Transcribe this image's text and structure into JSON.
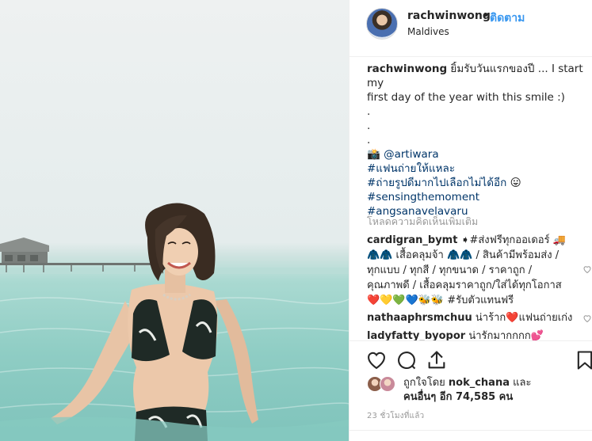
{
  "post": {
    "username": "rachwinwong",
    "dot": "•",
    "follow_label": "ติดตาม",
    "location": "Maldives"
  },
  "caption": {
    "username": "rachwinwong",
    "text_1": "ยิ้มรับวันแรกของปี ... I start my",
    "text_2": "first day of the year with this smile :)",
    "dots": [
      ".",
      ".",
      "."
    ],
    "camera_emoji": "📸",
    "mention": "@artiwara",
    "hashtags": [
      "#แฟนถ่ายให้แหละ",
      "#ถ่ายรูปดีมากไปเลือกไม่ได้อีก",
      "#sensingthemoment",
      "#angsanavelavaru"
    ],
    "hashtag_emoji": "😛"
  },
  "load_more": "โหลดความคิดเห็นเพิ่มเติม",
  "comments": [
    {
      "username": "cardigran_bymt",
      "lines": [
        "➧#ส่งฟรีทุกออเดอร์ 🚚",
        "🧥🧥 เสื้อคลุมจ้า 🧥🧥 / สินค้ามีพร้อมส่ง /",
        "ทุกแบบ / ทุกสี / ทุกขนาด / ราคาถูก /",
        "คุณภาพดี / เสื้อคลุมราคาถูก/ใส่ได้ทุกโอกาส",
        "❤️💛💚💙🐝🐝 #รับตัวแทนฟรี"
      ]
    },
    {
      "username": "nathaaphrsmchuu",
      "text": "น่าร้าก❤️แฟนถ่ายเก่ง"
    },
    {
      "username": "ladyfatty_byopor",
      "text": "น่ารักมากกกก💕"
    }
  ],
  "likes": {
    "prefix": "ถูกใจโดย",
    "user": "nok_chana",
    "conj": "และ",
    "others": "คนอื่นๆ อีก 74,585 คน"
  },
  "time_ago": "23 ชั่วโมงที่แล้ว",
  "colors": {
    "link": "#003569",
    "follow": "#3897f0",
    "muted": "#999999",
    "heart": "#ed4956"
  }
}
